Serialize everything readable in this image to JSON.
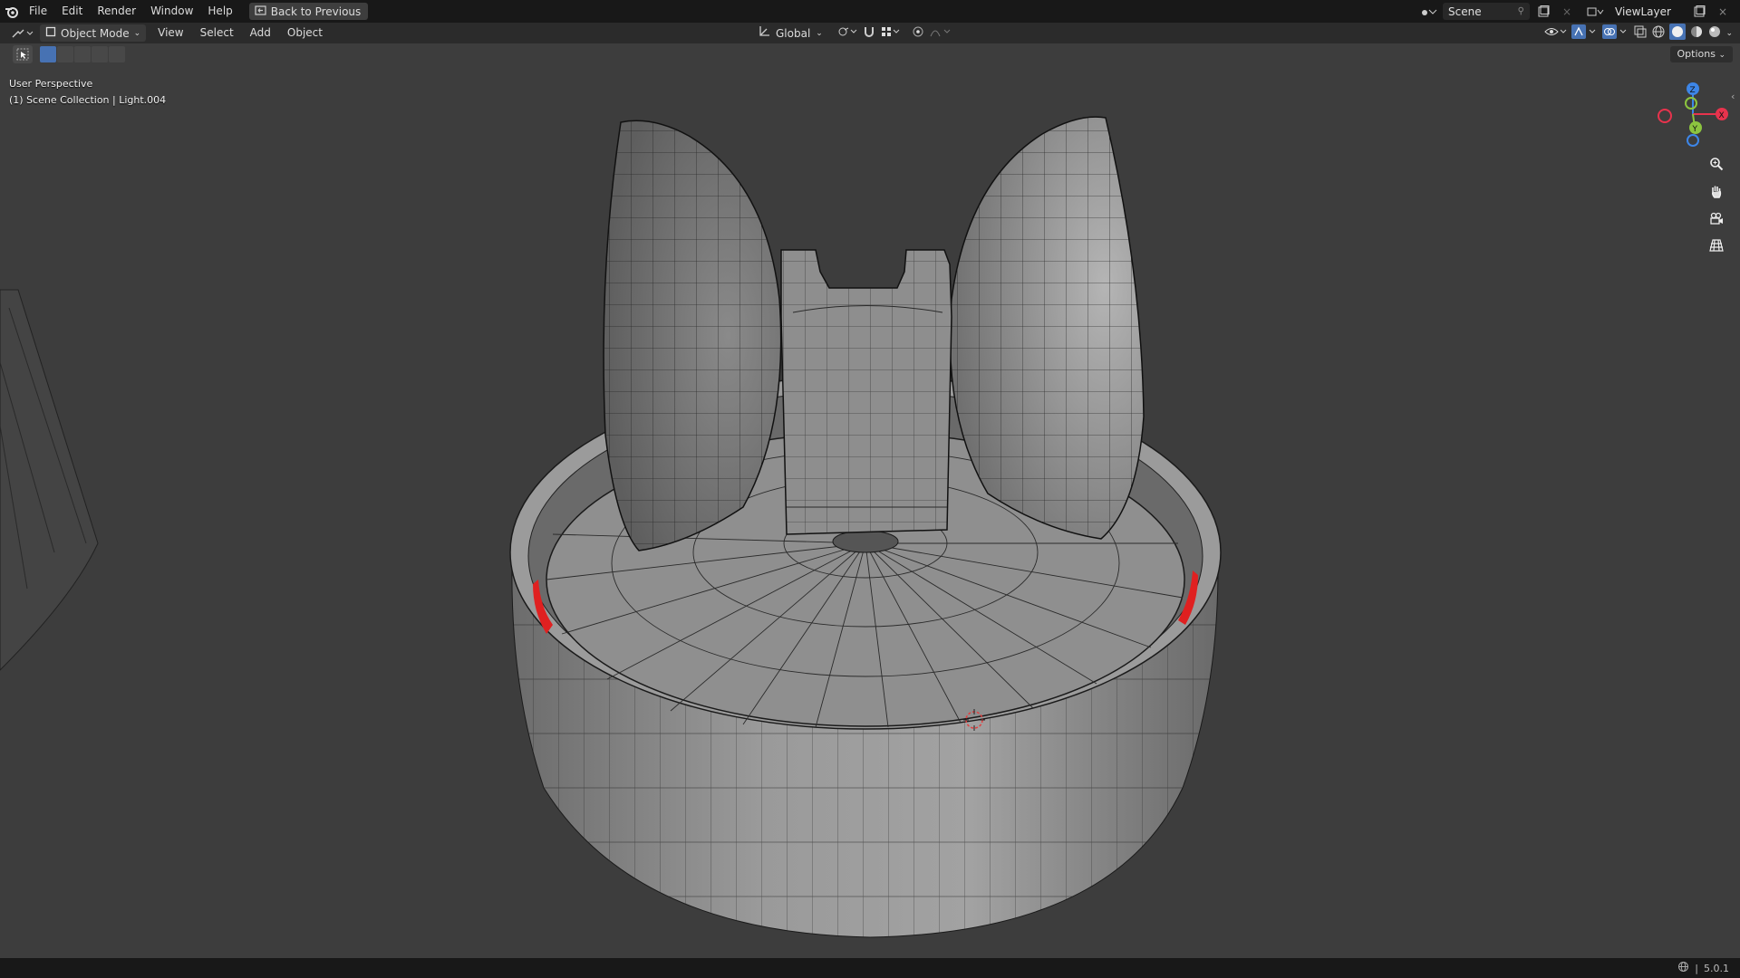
{
  "topbar": {
    "menus": [
      "File",
      "Edit",
      "Render",
      "Window",
      "Help"
    ],
    "back_button": "Back to Previous",
    "scene_name": "Scene",
    "view_layer": "ViewLayer"
  },
  "header": {
    "mode": "Object Mode",
    "menus": [
      "View",
      "Select",
      "Add",
      "Object"
    ],
    "transform_orientation": "Global"
  },
  "toolbar": {
    "options_label": "Options"
  },
  "viewport": {
    "perspective_label": "User Perspective",
    "collection_label": "(1) Scene Collection | Light.004"
  },
  "gizmo": {
    "x_label": "X",
    "y_label": "Y",
    "z_label": "Z"
  },
  "status": {
    "version": "5.0.1"
  },
  "colors": {
    "accent": "#4772b3",
    "x_axis": "#e8334d",
    "y_axis": "#8cc43f",
    "z_axis": "#3d86e8",
    "selection": "#ff2020"
  }
}
